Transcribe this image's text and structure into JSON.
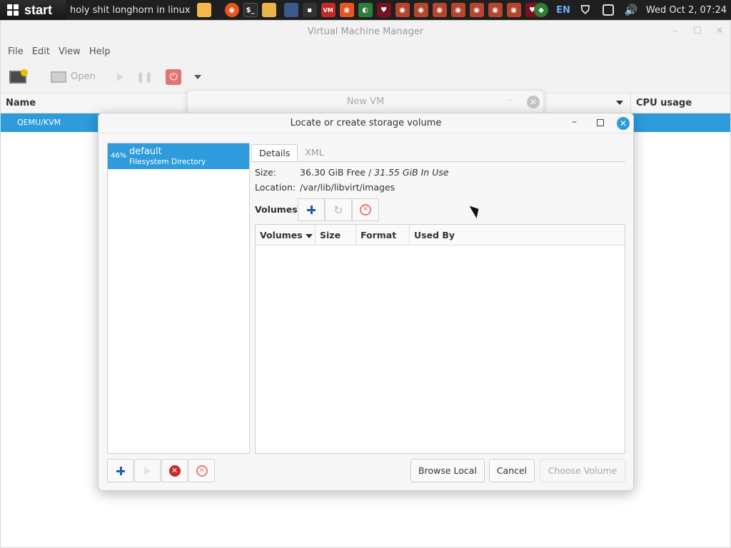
{
  "taskbar": {
    "start_label": "start",
    "active_task_title": "holy shit longhorn in linux",
    "language": "EN",
    "clock": "Wed Oct  2, 07:24",
    "app_icons": [
      "folder-icon",
      "ubuntu-icon",
      "terminal-icon",
      "files-icon",
      "network-icon",
      "terminal-small-icon",
      "vmm-icon",
      "ubuntu-icon",
      "shell-icon",
      "wine-icon",
      "ubuntu-icon",
      "ubuntu-icon",
      "ubuntu-icon",
      "ubuntu-icon",
      "ubuntu-icon",
      "ubuntu-icon",
      "ubuntu-icon",
      "wine-icon"
    ],
    "tray_icons": [
      "network-tray-icon",
      "shield-tray-icon",
      "window-tray-icon",
      "volume-tray-icon"
    ]
  },
  "main_window": {
    "title": "Virtual Machine Manager",
    "menu": [
      "File",
      "Edit",
      "View",
      "Help"
    ],
    "toolbar": {
      "open_label": "Open"
    },
    "columns": {
      "name": "Name",
      "cpu": "CPU usage"
    },
    "selected_connection": "QEMU/KVM"
  },
  "new_vm_window": {
    "title": "New VM"
  },
  "dialog": {
    "title": "Locate or create storage volume",
    "pool": {
      "percent": "46%",
      "name": "default",
      "type": "Filesystem Directory"
    },
    "tabs": [
      "Details",
      "XML"
    ],
    "size_label": "Size:",
    "size_free": "36.30 GiB Free / ",
    "size_used": "31.55 GiB In Use",
    "location_label": "Location:",
    "location_value": "/var/lib/libvirt/images",
    "volumes_label": "Volumes",
    "volume_columns": [
      "Volumes",
      "Size",
      "Format",
      "Used By"
    ],
    "buttons": {
      "browse_local": "Browse Local",
      "cancel": "Cancel",
      "choose_volume": "Choose Volume"
    }
  },
  "colors": {
    "accent": "#2d9bdc",
    "danger": "#c62828"
  }
}
